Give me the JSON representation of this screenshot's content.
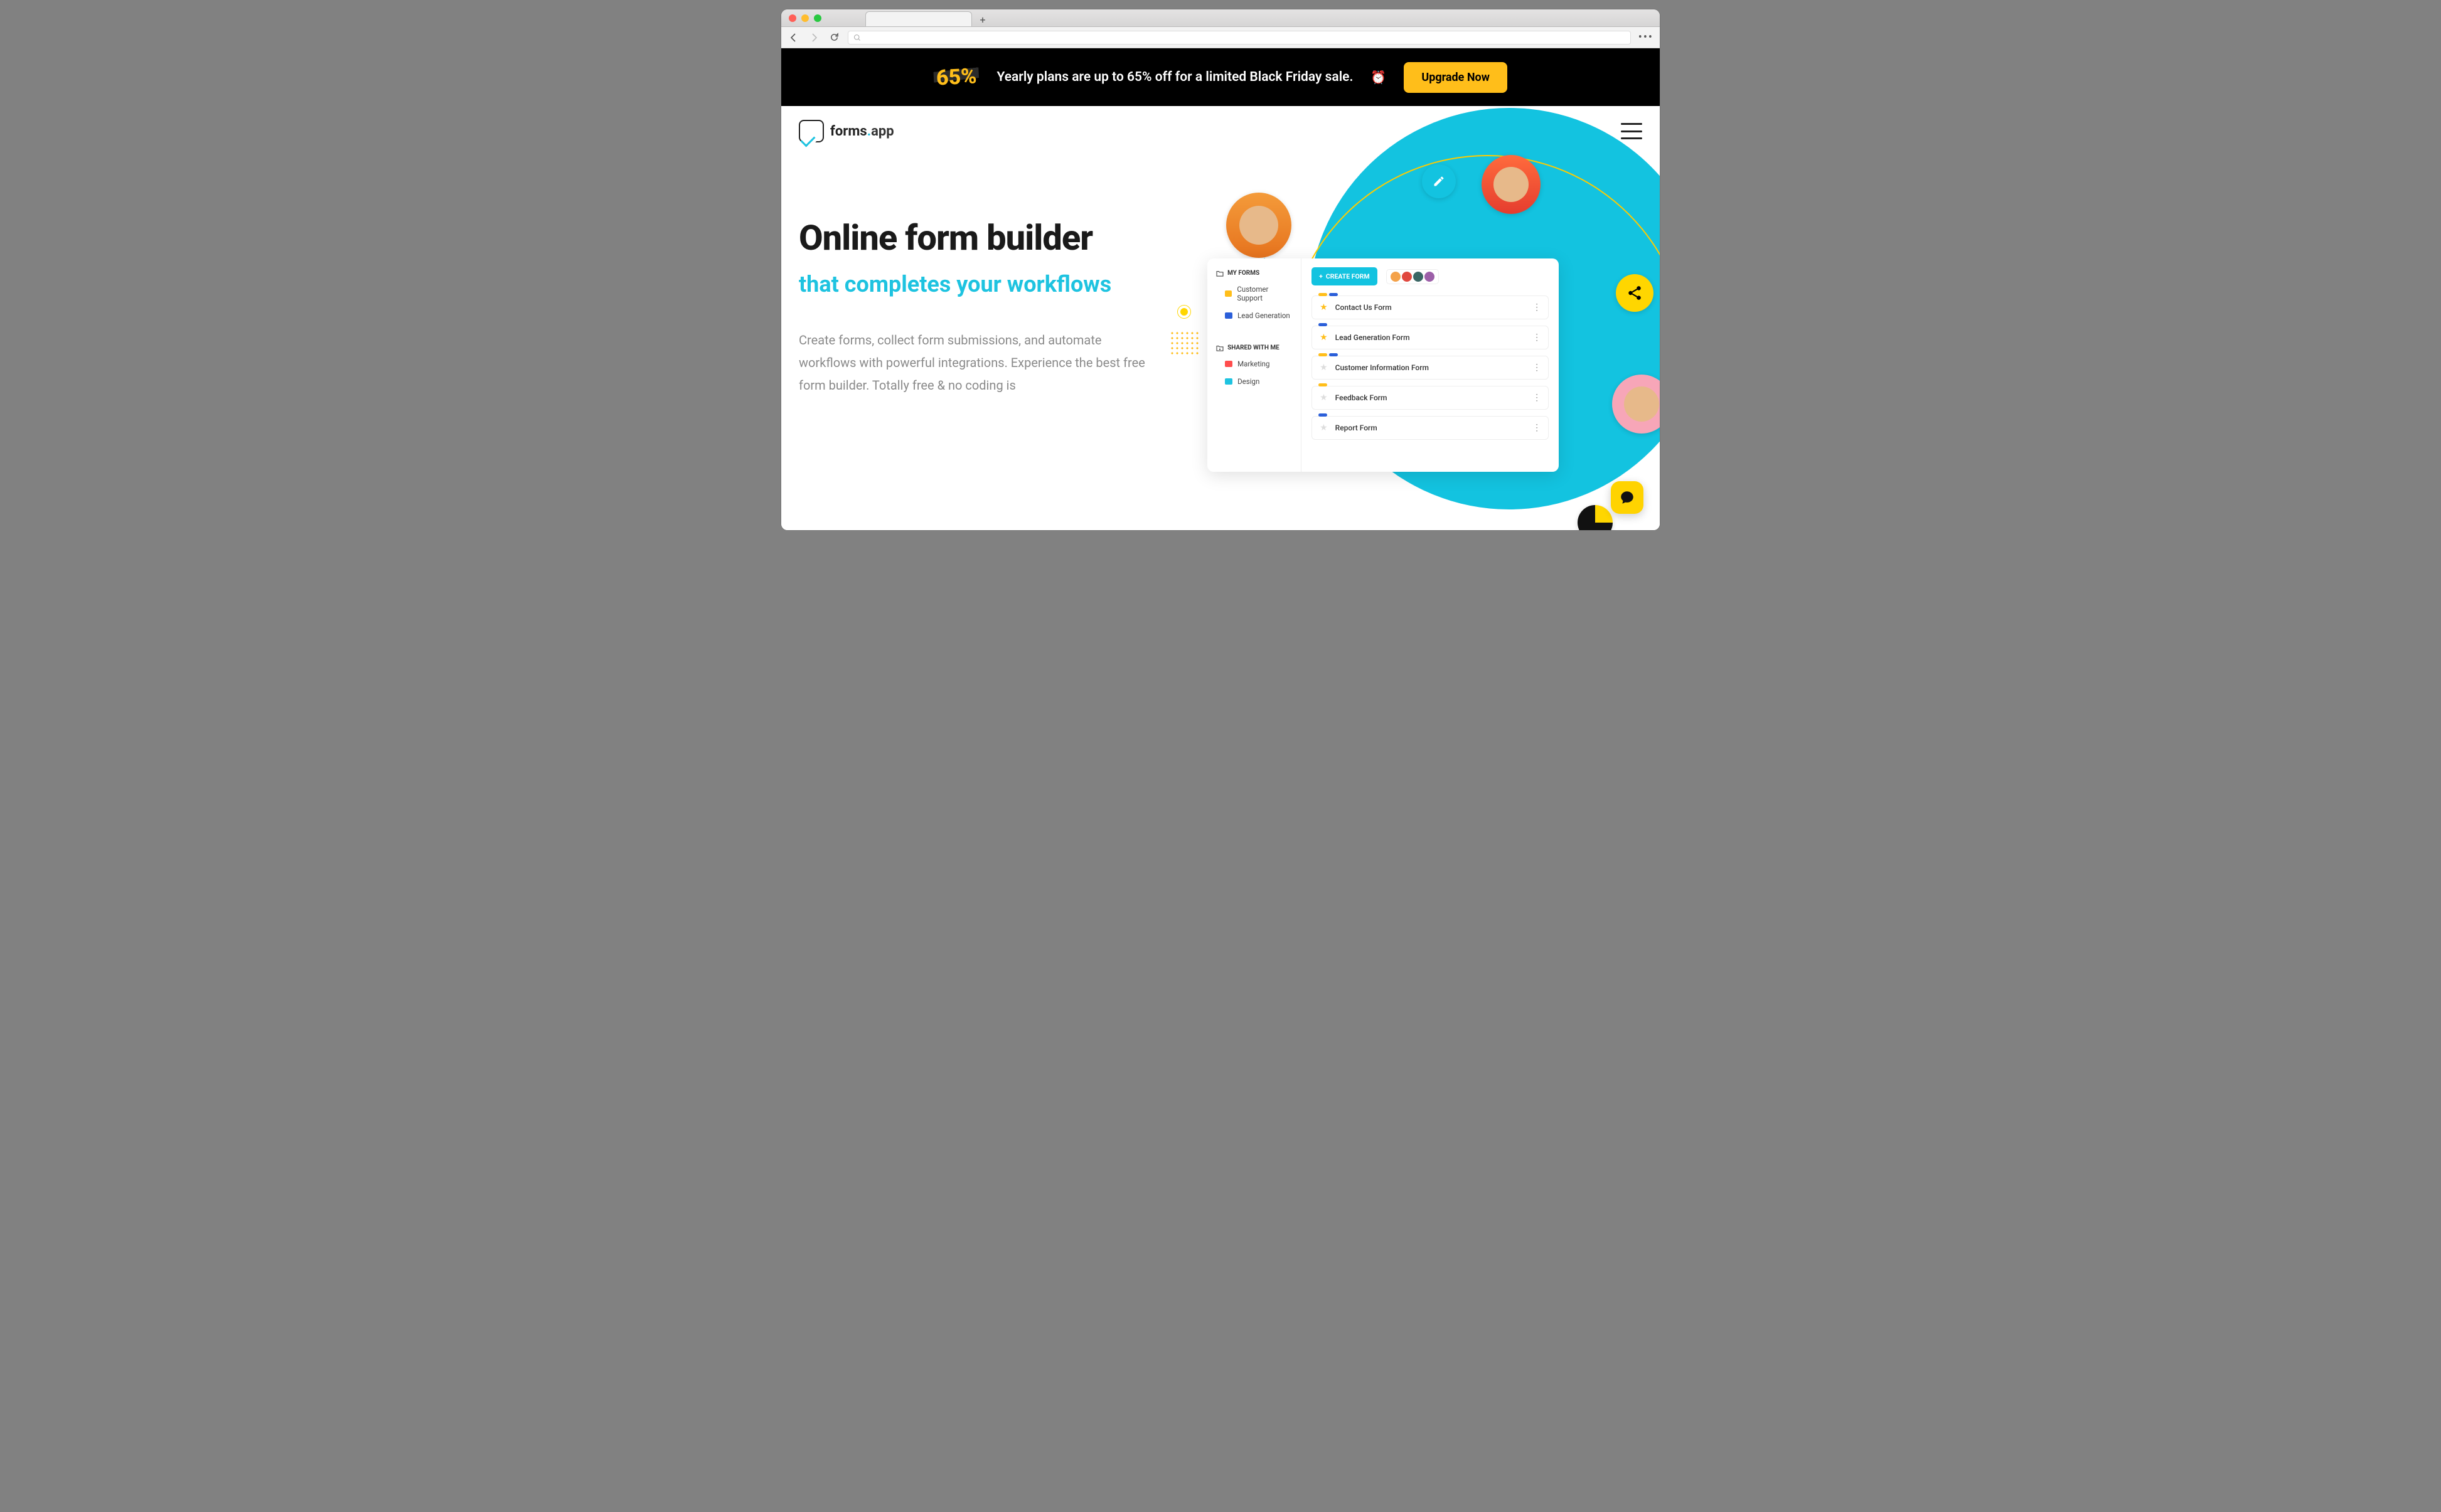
{
  "promo": {
    "badge": "65%",
    "text": "Yearly plans are up to 65% off for a limited Black Friday sale.",
    "emoji": "⏰",
    "cta": "Upgrade Now"
  },
  "brand": {
    "name_prefix": "forms",
    "name_suffix": "app"
  },
  "hero": {
    "headline": "Online form builder",
    "subhead": "that completes your workflows",
    "body": "Create forms, collect form submissions, and automate workflows with powerful integrations. Experience the best free form builder. Totally free & no coding is"
  },
  "mock": {
    "create_label": "CREATE FORM",
    "sections": {
      "my_forms": "MY FORMS",
      "shared": "SHARED WITH ME"
    },
    "my_forms_items": [
      {
        "label": "Customer Support",
        "color": "yellow"
      },
      {
        "label": "Lead Generation",
        "color": "blue"
      }
    ],
    "shared_items": [
      {
        "label": "Marketing",
        "color": "red"
      },
      {
        "label": "Design",
        "color": "cyan"
      }
    ],
    "forms": [
      {
        "name": "Contact Us Form",
        "starred": true,
        "bars": [
          "y",
          "b"
        ]
      },
      {
        "name": "Lead Generation Form",
        "starred": true,
        "bars": [
          "b"
        ]
      },
      {
        "name": "Customer Information Form",
        "starred": false,
        "bars": [
          "y",
          "b"
        ]
      },
      {
        "name": "Feedback Form",
        "starred": false,
        "bars": [
          "y"
        ]
      },
      {
        "name": "Report Form",
        "starred": false,
        "bars": [
          "b"
        ]
      }
    ]
  }
}
